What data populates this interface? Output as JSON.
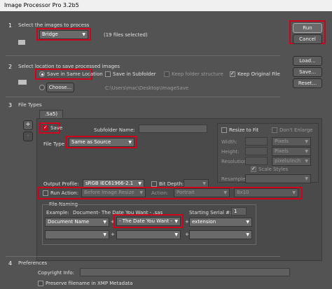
{
  "window": {
    "title": "Image Processor Pro 3.2b5"
  },
  "section1": {
    "num": "1",
    "select_label": "Select the images to process",
    "source_value": "Bridge",
    "files_selected": "(19 files selected)"
  },
  "section2": {
    "num": "2",
    "select_label": "Select location to save processed images",
    "save_same": "Save in Same Location",
    "save_subfolder": "Save in Subfolder",
    "keep_structure": "Keep folder structure",
    "keep_original": "Keep Original File",
    "choose_label": "Choose...",
    "path": "C:\\Users\\mac\\Desktop\\ImageSave"
  },
  "section3": {
    "num": "3",
    "file_types": "File Types",
    "tab_label": ".Sa5)",
    "plus": "+",
    "minus": "-",
    "save_label": "Save",
    "subfolder_name": "Subfolder Name:",
    "file_type": "File Type",
    "file_type_value": "Same as Source",
    "resize_to_fit": "Resize to Fit",
    "dont_enlarge": "Don't Enlarge",
    "width": "Width:",
    "height": "Height:",
    "resolution": "Resolution:",
    "pixels1": "Pixels",
    "pixels2": "Pixels",
    "pixels_inch": "pixels/inch",
    "scale_styles": "Scale Styles",
    "resample": "Resample:",
    "output_profile": "Output Profile:",
    "profile_value": "sRGB IEC61966-2.1",
    "bit_depth": "Bit Depth:",
    "run_action": "Run Action:",
    "action_set": "Before Image Resize",
    "action_label": "Action:",
    "action_set2": "Portrait",
    "action_value": "8x10",
    "file_naming": "File Naming",
    "example_label": "Example:",
    "example_value": "Document- The Date You Want - .sas",
    "starting_serial": "Starting Serial #:",
    "serial_value": "1",
    "naming1": "Document Name",
    "naming2": "- The Date You Want -",
    "naming3": "extension"
  },
  "section4": {
    "num": "4",
    "preferences": "Preferences",
    "copyright": "Copyright Info:",
    "preserve": "Preserve filename in XMP Metadata"
  },
  "buttons": {
    "run": "Run",
    "cancel": "Cancel",
    "load": "Load...",
    "save": "Save...",
    "reset": "Reset..."
  }
}
